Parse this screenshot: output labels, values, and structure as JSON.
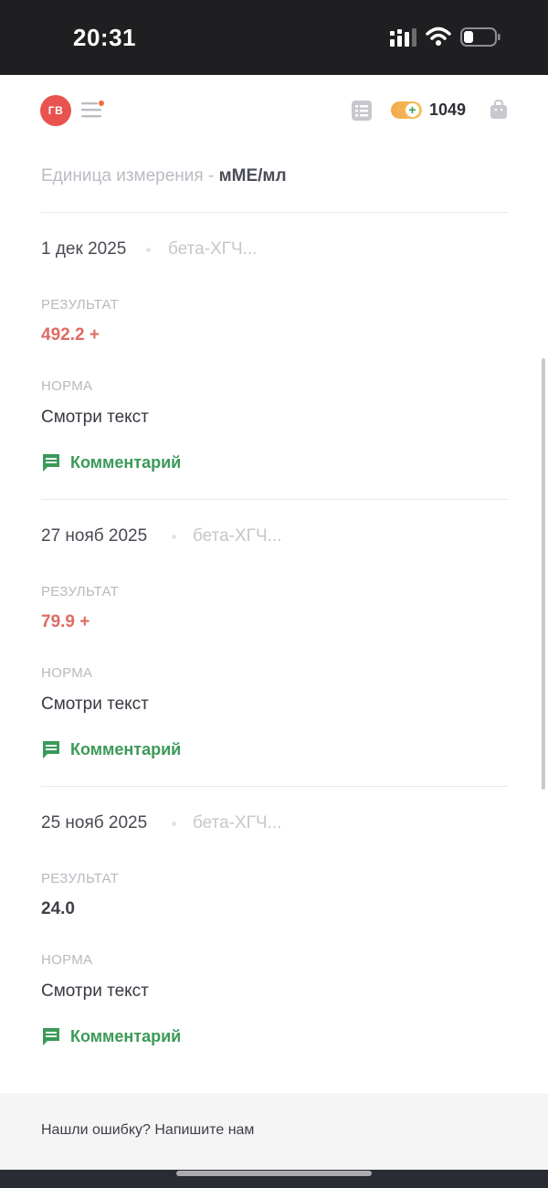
{
  "status_bar": {
    "time": "20:31"
  },
  "header": {
    "avatar_initials": "ГВ",
    "coins": "1049"
  },
  "unit": {
    "label": "Единица измерения - ",
    "value": "мМЕ/мл"
  },
  "entries": [
    {
      "date": "1 дек 2025",
      "test": "бета-ХГЧ...",
      "result_label": "РЕЗУЛЬТАТ",
      "result": "492.2 +",
      "norm_label": "НОРМА",
      "norm": "Смотри текст",
      "comment": "Комментарий"
    },
    {
      "date": "27 нояб 2025",
      "test": "бета-ХГЧ...",
      "result_label": "РЕЗУЛЬТАТ",
      "result": "79.9 +",
      "norm_label": "НОРМА",
      "norm": "Смотри текст",
      "comment": "Комментарий"
    },
    {
      "date": "25 нояб 2025",
      "test": "бета-ХГЧ...",
      "result_label": "РЕЗУЛЬТАТ",
      "result": "24.0",
      "norm_label": "НОРМА",
      "norm": "Смотри текст",
      "comment": "Комментарий"
    }
  ],
  "footer": {
    "text": "Нашли ошибку? Напишите нам"
  },
  "colors": {
    "alert": "#dd6b65",
    "accent_green": "#3b9a58",
    "avatar": "#e8534f"
  },
  "icons": [
    "signal-icon",
    "wifi-icon",
    "battery-icon",
    "menu-icon",
    "list-icon",
    "coin-plus-icon",
    "bag-icon",
    "comment-icon"
  ]
}
